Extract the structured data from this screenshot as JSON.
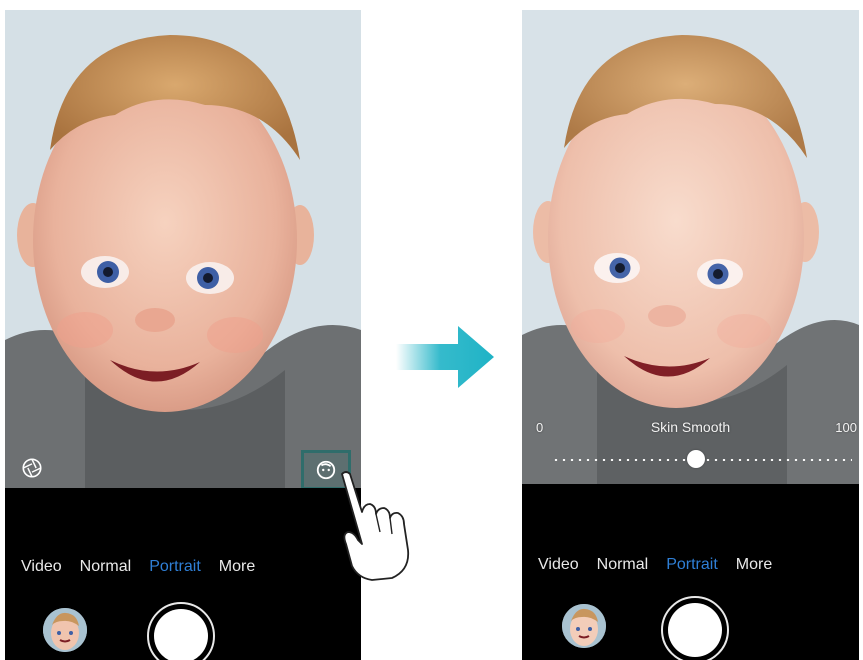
{
  "colors": {
    "accent": "#2f7fd6",
    "highlight_box": "#2f6d6b",
    "arrow": "#1fb3c6"
  },
  "left_phone": {
    "modes": [
      "Video",
      "Normal",
      "Portrait",
      "More"
    ],
    "active_mode": "Portrait",
    "icons": [
      "aperture-icon",
      "beauty-face-icon",
      "gallery-thumbnail",
      "shutter-button",
      "pointing-hand"
    ]
  },
  "right_phone": {
    "slider": {
      "label": "Skin Smooth",
      "min_label": "0",
      "max_label": "100",
      "value_fraction": 0.48
    },
    "modes": [
      "Video",
      "Normal",
      "Portrait",
      "More"
    ],
    "active_mode": "Portrait"
  }
}
